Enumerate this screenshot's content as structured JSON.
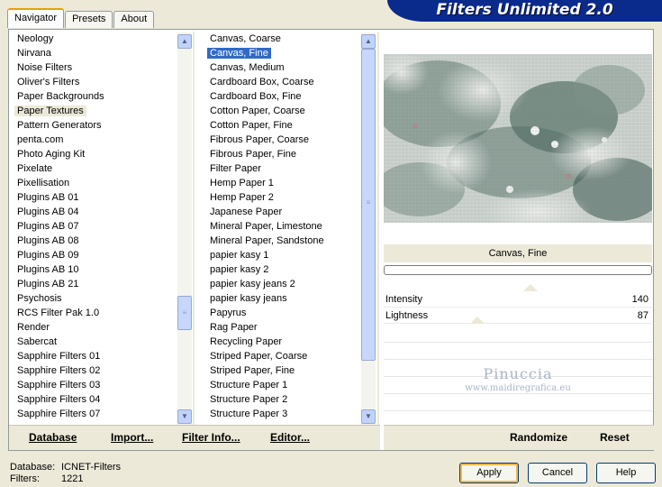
{
  "window": {
    "title": "Filters Unlimited 2.0"
  },
  "tabs": [
    {
      "label": "Navigator",
      "active": true
    },
    {
      "label": "Presets",
      "active": false
    },
    {
      "label": "About",
      "active": false
    }
  ],
  "categories": {
    "items": [
      "Neology",
      "Nirvana",
      "Noise Filters",
      "Oliver's Filters",
      "Paper Backgrounds",
      "Paper Textures",
      "Pattern Generators",
      "penta.com",
      "Photo Aging Kit",
      "Pixelate",
      "Pixellisation",
      "Plugins AB 01",
      "Plugins AB 04",
      "Plugins AB 07",
      "Plugins AB 08",
      "Plugins AB 09",
      "Plugins AB 10",
      "Plugins AB 21",
      "Psychosis",
      "RCS Filter Pak 1.0",
      "Render",
      "Sabercat",
      "Sapphire Filters 01",
      "Sapphire Filters 02",
      "Sapphire Filters 03",
      "Sapphire Filters 04",
      "Sapphire Filters 07"
    ],
    "selected": "Paper Textures"
  },
  "filters": {
    "items": [
      "Canvas, Coarse",
      "Canvas, Fine",
      "Canvas, Medium",
      "Cardboard Box, Coarse",
      "Cardboard Box, Fine",
      "Cotton Paper, Coarse",
      "Cotton Paper, Fine",
      "Fibrous Paper, Coarse",
      "Fibrous Paper, Fine",
      "Filter Paper",
      "Hemp Paper 1",
      "Hemp Paper 2",
      "Japanese Paper",
      "Mineral Paper, Limestone",
      "Mineral Paper, Sandstone",
      "papier kasy 1",
      "papier kasy 2",
      "papier kasy jeans 2",
      "papier kasy jeans",
      "Papyrus",
      "Rag Paper",
      "Recycling Paper",
      "Striped Paper, Coarse",
      "Striped Paper, Fine",
      "Structure Paper 1",
      "Structure Paper 2",
      "Structure Paper 3"
    ],
    "selected": "Canvas, Fine"
  },
  "toolbar": {
    "database": "Database",
    "import": "Import...",
    "filter_info": "Filter Info...",
    "editor": "Editor...",
    "randomize": "Randomize",
    "reset": "Reset"
  },
  "filter_panel": {
    "name": "Canvas, Fine",
    "progress": 0,
    "params": [
      {
        "label": "Intensity",
        "value": "140",
        "level": 0.55
      },
      {
        "label": "Lightness",
        "value": "87",
        "level": 0.34
      }
    ]
  },
  "watermark": {
    "line1": "Pinuccia",
    "line2": "www.maidiregrafica.eu"
  },
  "status": {
    "database_label": "Database:",
    "database_value": "ICNET-Filters",
    "filters_label": "Filters:",
    "filters_value": "1221"
  },
  "buttons": {
    "apply": "Apply",
    "cancel": "Cancel",
    "help": "Help"
  },
  "colors": {
    "banner": "#0a2a8c",
    "selection": "#316ac5",
    "background": "#ece9d8"
  }
}
